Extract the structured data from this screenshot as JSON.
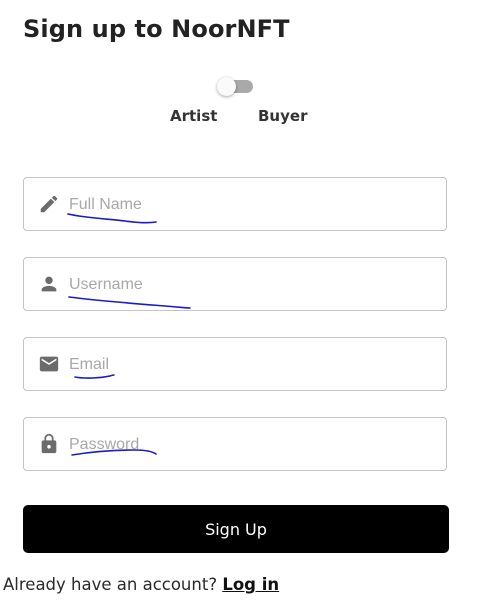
{
  "page": {
    "title": "Sign up to NoorNFT"
  },
  "role_toggle": {
    "left_label": "Artist",
    "right_label": "Buyer",
    "selected": "Artist"
  },
  "fields": {
    "full_name": {
      "placeholder": "Full Name",
      "value": "",
      "icon": "pencil-icon"
    },
    "username": {
      "placeholder": "Username",
      "value": "",
      "icon": "person-icon"
    },
    "email": {
      "placeholder": "Email",
      "value": "",
      "icon": "envelope-icon"
    },
    "password": {
      "placeholder": "Password",
      "value": "",
      "icon": "lock-icon"
    }
  },
  "actions": {
    "signup_label": "Sign Up",
    "login_prompt": "Already have an account?",
    "login_link": "Log in"
  },
  "colors": {
    "button_bg": "#000000",
    "button_text": "#ffffff",
    "annotation_ink": "#0000cc",
    "icon_gray": "#6b6b6b",
    "toggle_track": "#a9a9a9"
  }
}
